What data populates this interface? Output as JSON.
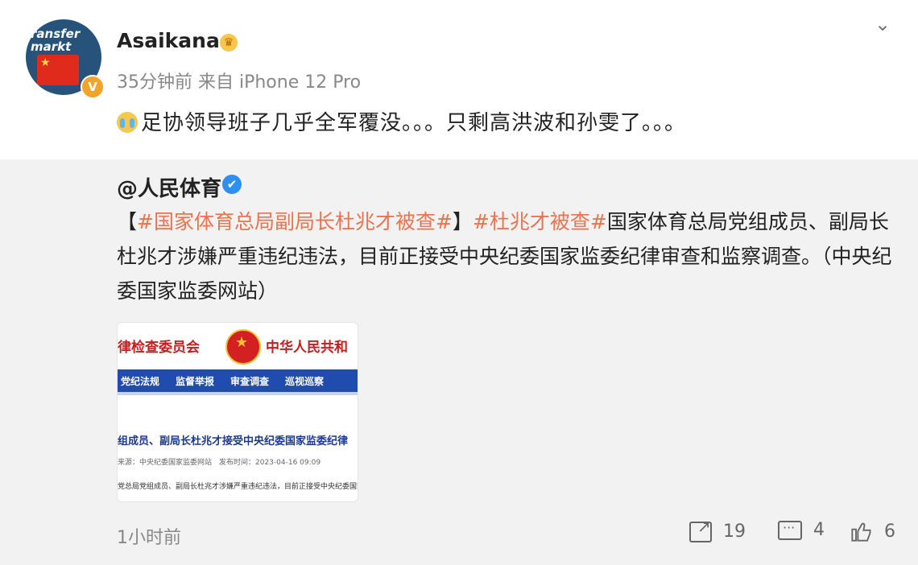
{
  "post": {
    "username": "Asaikana",
    "avatar_text": "ransfer\nmarkt",
    "verified_badge": "V",
    "meta": "35分钟前 来自 iPhone 12 Pro",
    "content": "足协领导班子几乎全军覆没。。。只剩高洪波和孙雯了。。。",
    "time": "1小时前"
  },
  "repost": {
    "author": "@人民体育",
    "verified_symbol": "✔",
    "bracket_open": "【",
    "hashtag_1": "#国家体育总局副局长杜兆才被查#",
    "bracket_close": "】",
    "hashtag_2": "#杜兆才被查#",
    "text": "国家体育总局党组成员、副局长杜兆才涉嫌严重违纪违法，目前正接受中央纪委国家监委纪律审查和监察调查。（中央纪委国家监委网站）"
  },
  "thumbnail": {
    "left_title": "律检查委员会",
    "right_title": "中华人民共和",
    "nav": [
      "党纪法规",
      "监督举报",
      "审查调查",
      "巡视巡察"
    ],
    "headline": "组成员、副局长杜兆才接受中央纪委国家监委纪律",
    "source": "来源：中央纪委国家监委网站　发布时间：2023-04-16 09:09",
    "body": "党总局党组成员、副局长杜兆才涉嫌严重违纪违法，目前正接受中央纪委国家"
  },
  "actions": {
    "share_count": "19",
    "comment_count": "4",
    "like_count": "6"
  },
  "icons": [
    "chevron-down-icon",
    "crown-icon",
    "cry-emoji-icon",
    "verified-icon",
    "share-icon",
    "comment-icon",
    "like-icon"
  ],
  "colors": {
    "hashtag": "#eb7350",
    "verified_blue": "#2e8ff0",
    "badge_orange": "#f0a52a"
  }
}
